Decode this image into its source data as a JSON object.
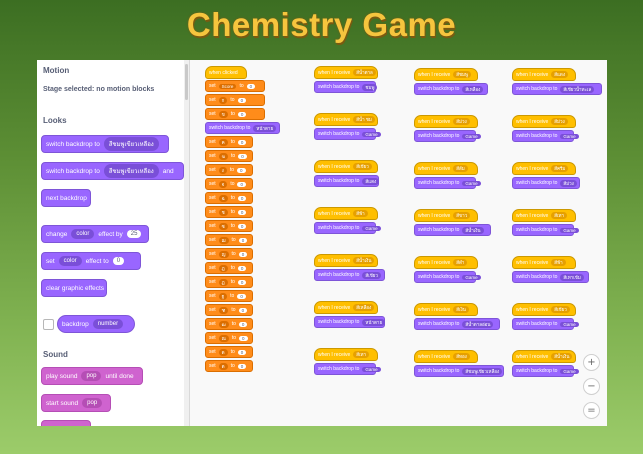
{
  "title": "Chemistry Game",
  "palette": {
    "motion_heading": "Motion",
    "motion_note": "Stage selected: no motion blocks",
    "looks_heading": "Looks",
    "switch1_label": "switch backdrop to",
    "switch1_value": "สีชมพูเขียวเหลือง",
    "switch2_label": "switch backdrop to",
    "switch2_value": "สีชมพูเขียวเหลือง",
    "switch2_tail": "and",
    "next_backdrop": "next backdrop",
    "change_label": "change",
    "change_effect": "color",
    "change_by": "effect by",
    "change_value": "25",
    "set_label": "set",
    "set_effect": "color",
    "set_to": "effect to",
    "set_value": "0",
    "clear_effects": "clear graphic effects",
    "backdrop_label": "backdrop",
    "backdrop_value": "number",
    "sound_heading": "Sound",
    "play_label": "play sound",
    "play_value": "pop",
    "play_tail": "until done",
    "start_label": "start sound",
    "start_value": "pop"
  },
  "canvas": {
    "script_hat": "when clicked",
    "set_label": "set",
    "to_label": "to",
    "set_rows": [
      {
        "var": "Score",
        "val": "0"
      },
      {
        "var": "ก",
        "val": "0"
      },
      {
        "var": "ข",
        "val": "0"
      }
    ],
    "switch_label": "switch backdrop to",
    "switch_value": "หน้าตาย",
    "set_rows2": [
      {
        "var": "ค",
        "val": "0"
      },
      {
        "var": "ฆ",
        "val": "0"
      },
      {
        "var": "ง",
        "val": "0"
      },
      {
        "var": "จ",
        "val": "0"
      },
      {
        "var": "ฉ",
        "val": "0"
      },
      {
        "var": "ช",
        "val": "0"
      },
      {
        "var": "ซ",
        "val": "0"
      },
      {
        "var": "ฌ",
        "val": "0"
      },
      {
        "var": "ญ",
        "val": "0"
      },
      {
        "var": "ฎ",
        "val": "0"
      },
      {
        "var": "ฏ",
        "val": "0"
      },
      {
        "var": "ฐ",
        "val": "0"
      },
      {
        "var": "ฑ",
        "val": "0"
      },
      {
        "var": "ฒ",
        "val": "0"
      },
      {
        "var": "ณ",
        "val": "0"
      },
      {
        "var": "ด",
        "val": "0"
      },
      {
        "var": "ต",
        "val": "0"
      }
    ],
    "hat_label": "when I receive",
    "switch_to": "switch backdrop to",
    "col1": [
      {
        "msg": "สีน้ำตาล",
        "bd": "ชมพู"
      },
      {
        "msg": "สีน้ำ ชม",
        "bd": "Game"
      },
      {
        "msg": "สีเขียว",
        "bd": "สีแดง"
      },
      {
        "msg": "สีฟ้า",
        "bd": "Game"
      },
      {
        "msg": "สีน้ำเงิน",
        "bd": "สีเขียว"
      },
      {
        "msg": "สีเหลือง",
        "bd": "หน้าตาย"
      },
      {
        "msg": "สีเทา",
        "bd": "Game"
      }
    ],
    "col2": [
      {
        "msg": "สีชมพู",
        "bd": "สีเหลือง"
      },
      {
        "msg": "สีม่วง",
        "bd": "Game"
      },
      {
        "msg": "สีส้ม",
        "bd": "Game"
      },
      {
        "msg": "สีขาว",
        "bd": "สีน้ำเงิน"
      },
      {
        "msg": "สีดำ",
        "bd": "Game"
      },
      {
        "msg": "สีเงิน",
        "bd": "สีน้ำตาลอ่อน"
      },
      {
        "msg": "สีทอง",
        "bd": "สีชมพูเขียวเหลือง"
      }
    ],
    "col3": [
      {
        "msg": "สีแดง",
        "bd": "สีเขียวน้ำทะเล"
      },
      {
        "msg": "สีม่วง",
        "bd": "Game"
      },
      {
        "msg": "สีครีม",
        "bd": "สีม่วง"
      },
      {
        "msg": "สีเทา",
        "bd": "Game"
      },
      {
        "msg": "สีฟ้า",
        "bd": "สีเทาเข้ม"
      },
      {
        "msg": "สีเขียว",
        "bd": "Game"
      },
      {
        "msg": "สีน้ำเงิน",
        "bd": "Game"
      }
    ],
    "zoom_in": "+",
    "zoom_out": "−",
    "zoom_reset": "="
  },
  "colors": {
    "looks": "#9966ff",
    "events": "#ffbf00",
    "variables": "#ff8c1a",
    "sound": "#cf63cf"
  }
}
